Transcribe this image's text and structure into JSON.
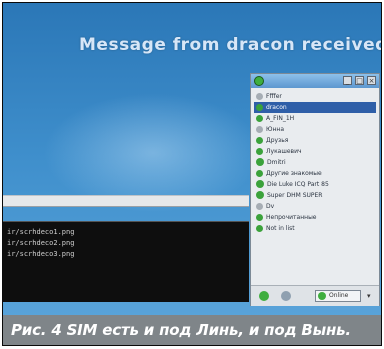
{
  "notification": {
    "text": "Message from dracon received"
  },
  "terminal": {
    "lines": [
      "ir/scrhdeco1.png",
      "ir/scrhdeco2.png",
      "ir/scrhdeco3.png"
    ]
  },
  "roster": {
    "contacts": [
      {
        "label": "Ffffer",
        "status": "offline"
      },
      {
        "label": "dracon",
        "status": "online",
        "selected": true
      },
      {
        "label": "A_FIN_1H",
        "status": "online"
      },
      {
        "label": "Юнна",
        "status": "offline"
      },
      {
        "label": "Друзья",
        "status": "online"
      },
      {
        "label": "Лукашевич",
        "status": "online"
      },
      {
        "label": "Dmitri",
        "status": "online"
      },
      {
        "label": "Другие знакомые",
        "status": "online"
      },
      {
        "label": "Die Luke ICQ Part 85",
        "status": "online"
      },
      {
        "label": "Super DHM SUPER",
        "status": "online"
      },
      {
        "label": "Dv",
        "status": "offline"
      },
      {
        "label": "Непрочитанные",
        "status": "online"
      },
      {
        "label": "Not in list",
        "status": "online"
      }
    ],
    "status_button": "Online"
  },
  "caption": {
    "text": "Рис. 4 SIM есть и под Линь, и под Вынь."
  }
}
